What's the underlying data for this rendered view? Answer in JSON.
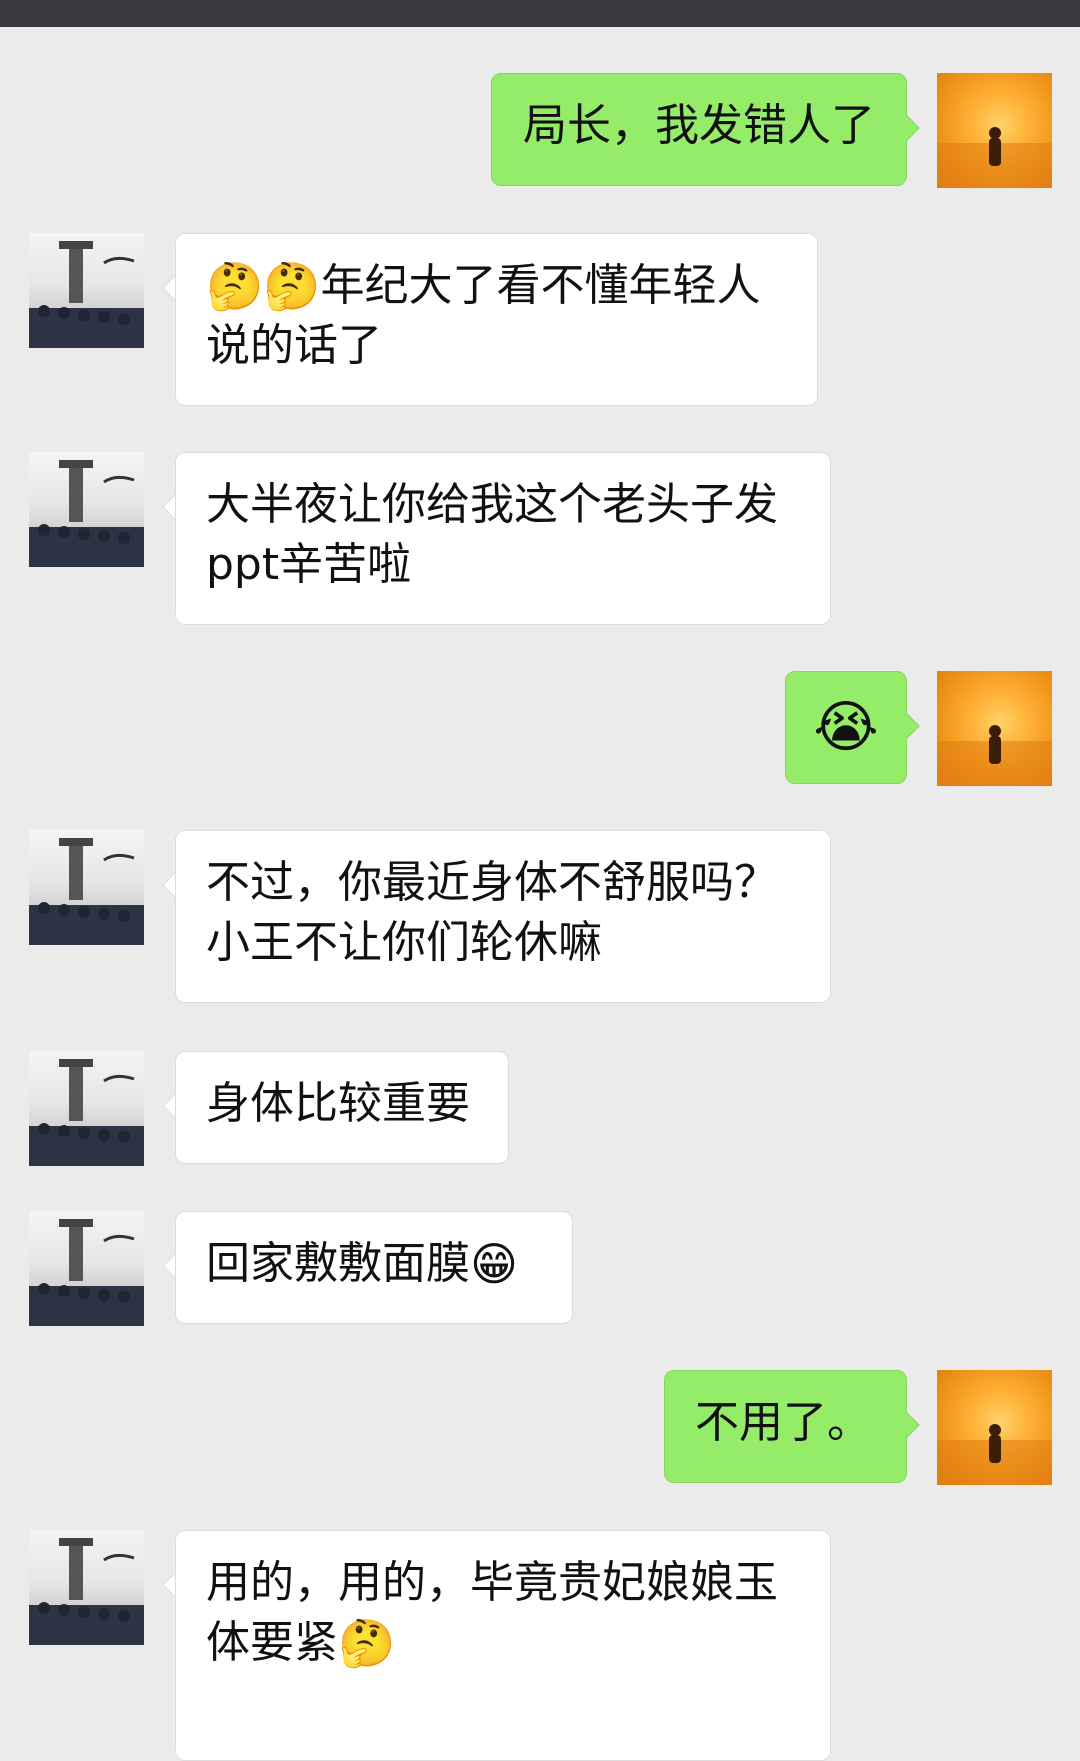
{
  "messages": [
    {
      "side": "out",
      "text": "局长，我发错人了"
    },
    {
      "side": "in",
      "emoji_prefix": "🤔🤔",
      "text": "年纪大了看不懂年轻人说的话了"
    },
    {
      "side": "in",
      "text": "大半夜让你给我这个老头子发ppt辛苦啦"
    },
    {
      "side": "out",
      "emoji": "😭"
    },
    {
      "side": "in",
      "text": "不过，你最近身体不舒服吗？小王不让你们轮休嘛"
    },
    {
      "side": "in",
      "text": "身体比较重要"
    },
    {
      "side": "in",
      "text": "回家敷敷面膜",
      "emoji_suffix": "😁"
    },
    {
      "side": "out",
      "text": "不用了。"
    },
    {
      "side": "in",
      "text": "用的，用的，毕竟贵妃娘娘玉体要紧",
      "emoji_suffix": "🤔"
    }
  ],
  "avatars": {
    "other": "official-avatar",
    "me": "sunset-avatar"
  }
}
